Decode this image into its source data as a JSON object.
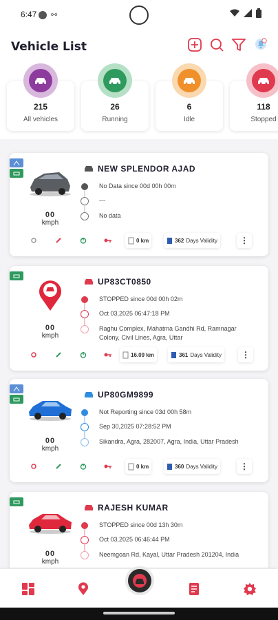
{
  "status_bar": {
    "time": "6:47"
  },
  "header": {
    "title": "Vehicle List"
  },
  "summary": [
    {
      "count": "215",
      "label": "All vehicles",
      "color": "#8e3b9e",
      "ring": "#d9b8de"
    },
    {
      "count": "26",
      "label": "Running",
      "color": "#2e9a5e",
      "ring": "#b6e0c6"
    },
    {
      "count": "6",
      "label": "Idle",
      "color": "#f0902a",
      "ring": "#fad8b0"
    },
    {
      "count": "118",
      "label": "Stopped",
      "color": "#e03a4f",
      "ring": "#f6c0c8"
    }
  ],
  "vehicles": [
    {
      "name": "NEW SPLENDOR AJAD",
      "status": "No Data since  00d 00h 00m",
      "time": "---",
      "address": "No data",
      "speed": "00",
      "unit": "kmph",
      "distance": "0 km",
      "validity_num": "362",
      "validity_label": "Days Validity",
      "accent": "#555555"
    },
    {
      "name": "UP83CT0850",
      "status": "STOPPED since  00d 00h 02m",
      "time": "Oct 03,2025 06:47:18 PM",
      "address": "Raghu Complex, Mahatma Gandhi Rd, Ramnagar Colony, Civil Lines, Agra, Uttar",
      "speed": "00",
      "unit": "kmph",
      "distance": "16.09 km",
      "validity_num": "361",
      "validity_label": "Days Validity",
      "accent": "#e03a4f"
    },
    {
      "name": "UP80GM9899",
      "status": "Not Reporting since  03d 00h 58m",
      "time": "Sep 30,2025 07:28:52 PM",
      "address": "Sikandra, Agra, 282007, Agra, India, Uttar Pradesh",
      "speed": "00",
      "unit": "kmph",
      "distance": "0 km",
      "validity_num": "360",
      "validity_label": "Days Validity",
      "accent": "#2f8de0"
    },
    {
      "name": "RAJESH KUMAR",
      "status": "STOPPED since  00d 13h 30m",
      "time": "Oct 03,2025 06:46:44 PM",
      "address": "Neemgoan Rd, Kayal, Uttar Pradesh 201204, India",
      "speed": "00",
      "unit": "kmph",
      "accent": "#e03a4f"
    }
  ],
  "colors": {
    "brand_red": "#e03a4f",
    "green": "#2e9a5e",
    "blue": "#2f8de0"
  }
}
